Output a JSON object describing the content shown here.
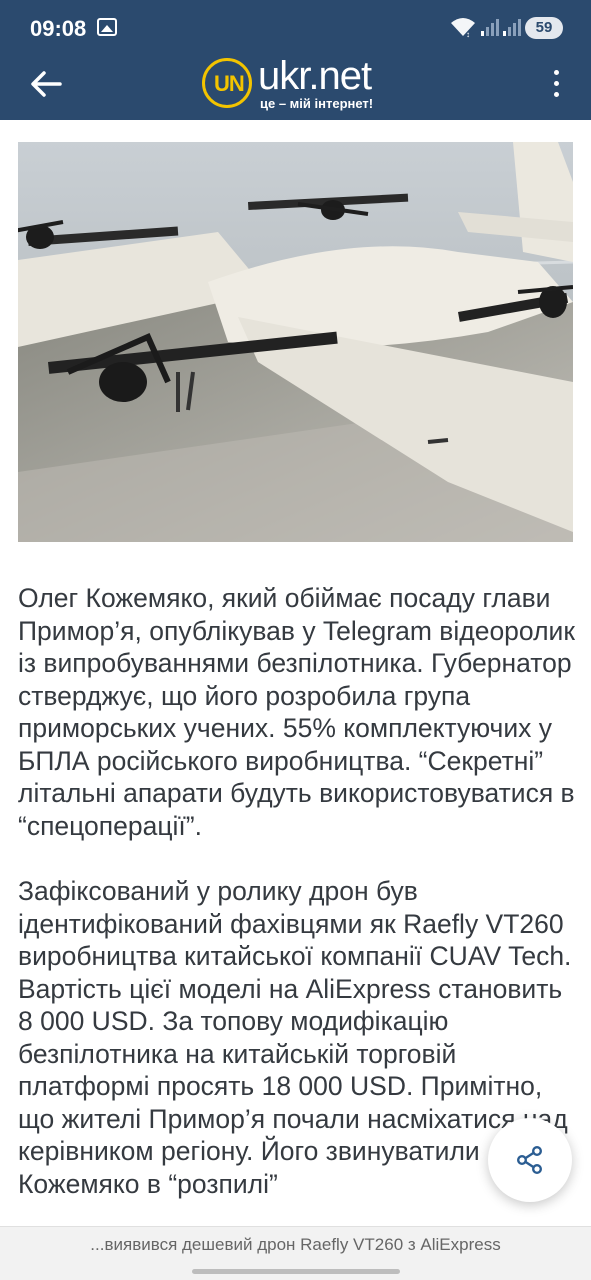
{
  "status_bar": {
    "time": "09:08",
    "battery": "59",
    "icons": [
      "gallery-icon",
      "wifi-icon",
      "signal-icon",
      "signal-icon",
      "battery-icon"
    ]
  },
  "header": {
    "logo_mark": "UN",
    "logo_text": "ukr.net",
    "tagline": "це – мій інтернет!",
    "back_icon": "arrow-left-icon",
    "menu_icon": "more-vertical-icon",
    "background_color": "#2b4a6e",
    "accent_color": "#f3c400"
  },
  "article": {
    "paragraphs": [
      "Олег Кожемяко, який обіймає посаду глави Примор’я, опублікував у Telegram відеоролик із випробуваннями безпілотника. Губернатор стверджує, що його розробила група приморських учених. 55% комплектуючих у БПЛА російського виробництва. “Секретні” літальні апарати будуть використовуватися в “спецоперації”.",
      "Зафіксований у ролику дрон був ідентифікований фахівцями як Raefly VT260 виробництва китайської компанії CUAV Tech. Вартість цієї моделі на AliExpress становить 8 000 USD. За топову модифікацію безпілотника на китайській торговій платформі просять 18 000 USD. Примітно, що жителі Примор’я почали насміхатися над керівником регіону. Його звинуватили Кожемяко в “розпилі”"
    ]
  },
  "share": {
    "icon": "share-icon"
  },
  "bottom_bar": {
    "title": "...виявився дешевий дрон Raefly VT260 з AliExpress"
  }
}
